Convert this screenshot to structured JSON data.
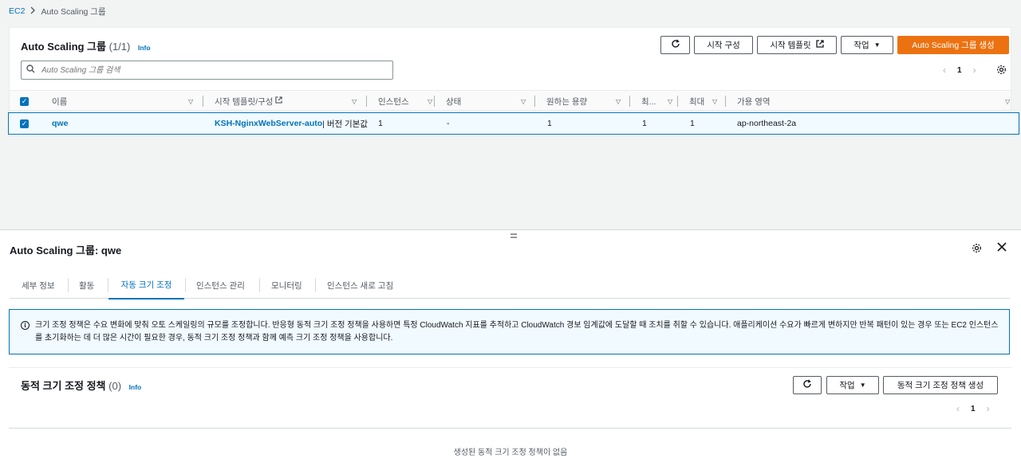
{
  "breadcrumb": {
    "root": "EC2",
    "current": "Auto Scaling 그룹"
  },
  "groups_panel": {
    "title": "Auto Scaling 그룹",
    "count": "(1/1)",
    "info": "Info",
    "buttons": {
      "launch_config": "시작 구성",
      "launch_template": "시작 템플릿",
      "actions": "작업",
      "create": "Auto Scaling 그룹 생성"
    },
    "search_placeholder": "Auto Scaling 그룹 검색",
    "page": "1",
    "columns": [
      "이름",
      "시작 템플릿/구성",
      "인스턴스",
      "상태",
      "원하는 용량",
      "최...",
      "최대",
      "가용 영역"
    ],
    "rows": [
      {
        "name": "qwe",
        "template": "KSH-NginxWebServer-auto",
        "template_suffix": " | 버전 기본값",
        "instances": "1",
        "status": "-",
        "desired": "1",
        "min": "1",
        "max": "1",
        "az": "ap-northeast-2a"
      }
    ]
  },
  "detail": {
    "title": "Auto Scaling 그룹: qwe",
    "tabs": [
      "세부 정보",
      "활동",
      "자동 크기 조정",
      "인스턴스 관리",
      "모니터링",
      "인스턴스 새로 고침"
    ],
    "active_tab": "자동 크기 조정",
    "alert_text": "크기 조정 정책은 수요 변화에 맞춰 오토 스케일링의 규모를 조정합니다. 반응형 동적 크기 조정 정책을 사용하면 특정 CloudWatch 지표를 추적하고 CloudWatch 경보 임계값에 도달할 때 조치를 취할 수 있습니다. 애플리케이션 수요가 빠르게 변하지만 반복 패턴이 있는 경우 또는 EC2 인스턴스를 초기화하는 데 더 많은 시간이 필요한 경우, 동적 크기 조정 정책과 함께 예측 크기 조정 정책을 사용합니다.",
    "policies": {
      "title": "동적 크기 조정 정책",
      "count": "(0)",
      "info": "Info",
      "actions": "작업",
      "create": "동적 크기 조정 정책 생성",
      "page": "1",
      "empty": "생성된 동적 크기 조정 정책이 없음"
    }
  },
  "colors": {
    "link": "#0073bb",
    "primary": "#ec7211",
    "selected_bg": "#f1faff"
  },
  "icons": [
    "chevron-right-icon",
    "refresh-icon",
    "external-link-icon",
    "caret-down-icon",
    "search-icon",
    "gear-icon",
    "close-icon",
    "info-icon",
    "drag-handle-icon"
  ]
}
